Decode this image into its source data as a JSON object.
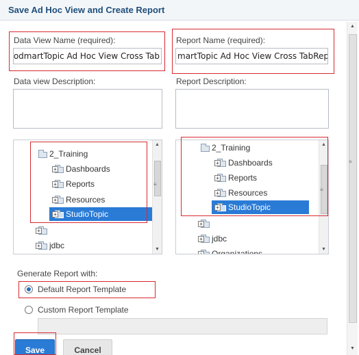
{
  "dialog": {
    "title": "Save Ad Hoc View and Create Report"
  },
  "data_view": {
    "name_label": "Data View Name (required):",
    "name_value": "FoodmartTopic Ad Hoc View Cross Tab",
    "description_label": "Data view Description:"
  },
  "report": {
    "name_label": "Report Name (required):",
    "name_value": "martTopic Ad Hoc View Cross TabRepor",
    "description_label": "Report Description:"
  },
  "left_tree": {
    "items": [
      {
        "label": "2_Training"
      },
      {
        "label": "Dashboards"
      },
      {
        "label": "Reports"
      },
      {
        "label": "Resources"
      },
      {
        "label": "StudioTopic"
      },
      {
        "label": "jdbc"
      }
    ]
  },
  "right_tree": {
    "items": [
      {
        "label": "2_Training"
      },
      {
        "label": "Dashboards"
      },
      {
        "label": "Reports"
      },
      {
        "label": "Resources"
      },
      {
        "label": "StudioTopic"
      },
      {
        "label": "jdbc"
      },
      {
        "label": "Organizations"
      }
    ]
  },
  "generate": {
    "label": "Generate Report with:",
    "default_option": "Default Report Template",
    "custom_option": "Custom Report Template"
  },
  "buttons": {
    "save": "Save",
    "cancel": "Cancel"
  },
  "colors": {
    "title": "#1f4e79",
    "highlight": "#d7282f",
    "selection": "#2a7bd6"
  }
}
